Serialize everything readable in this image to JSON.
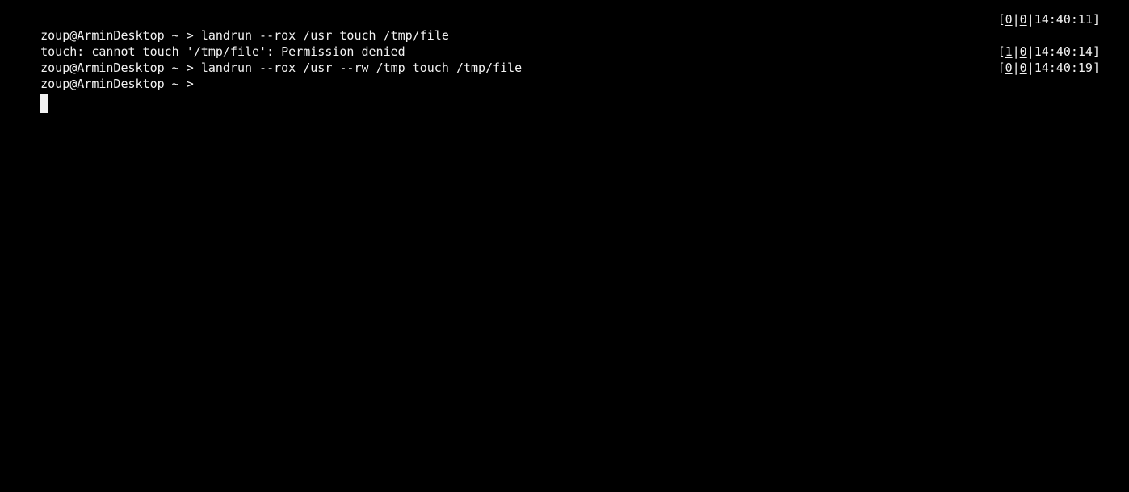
{
  "terminal": {
    "lines": [
      {
        "prompt": "zoup@ArminDesktop ~ > ",
        "command": "landrun --rox /usr touch /tmp/file",
        "status": {
          "jobs": "0",
          "exit": "0",
          "time": "14:40:11"
        }
      },
      {
        "output": "touch: cannot touch '/tmp/file': Permission denied"
      },
      {
        "prompt": "zoup@ArminDesktop ~ > ",
        "command": "landrun --rox /usr --rw /tmp touch /tmp/file",
        "status": {
          "jobs": "1",
          "exit": "0",
          "time": "14:40:14"
        }
      },
      {
        "prompt": "zoup@ArminDesktop ~ > ",
        "command": "",
        "status": {
          "jobs": "0",
          "exit": "0",
          "time": "14:40:19"
        }
      }
    ],
    "rprompt_open": "[",
    "rprompt_sep": "|",
    "rprompt_close": "]",
    "cursor_icon": "block-cursor-icon"
  },
  "colors": {
    "background": "#000000",
    "foreground": "#f2f2f2"
  }
}
